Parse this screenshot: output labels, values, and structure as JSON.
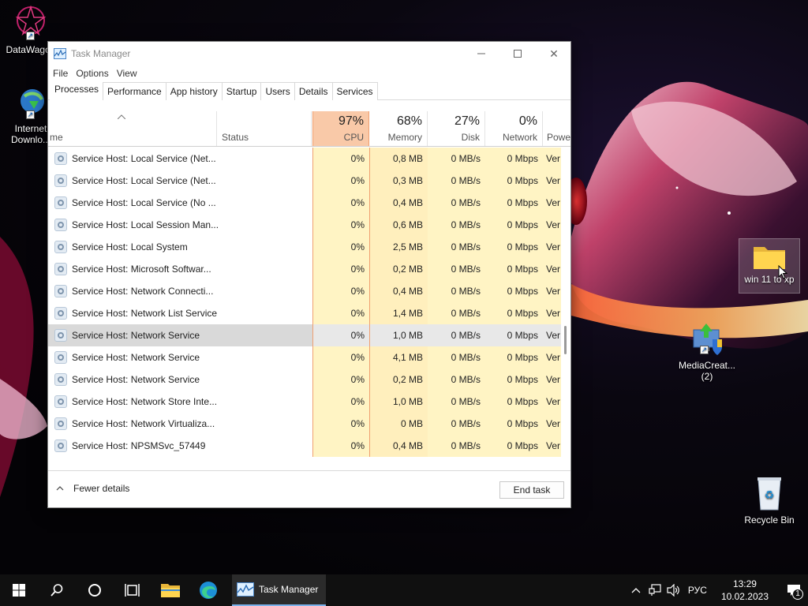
{
  "desktop": {
    "icons": [
      {
        "label": "DataWagon"
      },
      {
        "label": "Internet Downlo..."
      },
      {
        "label": "win 11 to xp"
      },
      {
        "label": "MediaCreat... (2)"
      },
      {
        "label": "Recycle Bin"
      }
    ]
  },
  "window": {
    "title": "Task Manager",
    "close_glyph": "✕",
    "menu": [
      "File",
      "Options",
      "View"
    ],
    "tabs": [
      "Processes",
      "Performance",
      "App history",
      "Startup",
      "Users",
      "Details",
      "Services"
    ],
    "active_tab": "Processes"
  },
  "table": {
    "columns": {
      "name": "me",
      "status": "Status",
      "cpu": {
        "pct": "97%",
        "label": "CPU"
      },
      "memory": {
        "pct": "68%",
        "label": "Memory"
      },
      "disk": {
        "pct": "27%",
        "label": "Disk"
      },
      "network": {
        "pct": "0%",
        "label": "Network"
      },
      "power": {
        "label": "Powe"
      }
    },
    "rows": [
      {
        "name": "Service Host: Local Service (Net...",
        "cpu": "0%",
        "mem": "0,8 MB",
        "disk": "0 MB/s",
        "net": "0 Mbps",
        "power": "Ver"
      },
      {
        "name": "Service Host: Local Service (Net...",
        "cpu": "0%",
        "mem": "0,3 MB",
        "disk": "0 MB/s",
        "net": "0 Mbps",
        "power": "Ver"
      },
      {
        "name": "Service Host: Local Service (No ...",
        "cpu": "0%",
        "mem": "0,4 MB",
        "disk": "0 MB/s",
        "net": "0 Mbps",
        "power": "Ver"
      },
      {
        "name": "Service Host: Local Session Man...",
        "cpu": "0%",
        "mem": "0,6 MB",
        "disk": "0 MB/s",
        "net": "0 Mbps",
        "power": "Ver"
      },
      {
        "name": "Service Host: Local System",
        "cpu": "0%",
        "mem": "2,5 MB",
        "disk": "0 MB/s",
        "net": "0 Mbps",
        "power": "Ver"
      },
      {
        "name": "Service Host: Microsoft Softwar...",
        "cpu": "0%",
        "mem": "0,2 MB",
        "disk": "0 MB/s",
        "net": "0 Mbps",
        "power": "Ver"
      },
      {
        "name": "Service Host: Network Connecti...",
        "cpu": "0%",
        "mem": "0,4 MB",
        "disk": "0 MB/s",
        "net": "0 Mbps",
        "power": "Ver"
      },
      {
        "name": "Service Host: Network List Service",
        "cpu": "0%",
        "mem": "1,4 MB",
        "disk": "0 MB/s",
        "net": "0 Mbps",
        "power": "Ver"
      },
      {
        "name": "Service Host: Network Service",
        "cpu": "0%",
        "mem": "1,0 MB",
        "disk": "0 MB/s",
        "net": "0 Mbps",
        "power": "Ver"
      },
      {
        "name": "Service Host: Network Service",
        "cpu": "0%",
        "mem": "4,1 MB",
        "disk": "0 MB/s",
        "net": "0 Mbps",
        "power": "Ver"
      },
      {
        "name": "Service Host: Network Service",
        "cpu": "0%",
        "mem": "0,2 MB",
        "disk": "0 MB/s",
        "net": "0 Mbps",
        "power": "Ver"
      },
      {
        "name": "Service Host: Network Store Inte...",
        "cpu": "0%",
        "mem": "1,0 MB",
        "disk": "0 MB/s",
        "net": "0 Mbps",
        "power": "Ver"
      },
      {
        "name": "Service Host: Network Virtualiza...",
        "cpu": "0%",
        "mem": "0 MB",
        "disk": "0 MB/s",
        "net": "0 Mbps",
        "power": "Ver"
      },
      {
        "name": "Service Host: NPSMSvc_57449",
        "cpu": "0%",
        "mem": "0,4 MB",
        "disk": "0 MB/s",
        "net": "0 Mbps",
        "power": "Ver"
      }
    ],
    "selected_row": 8
  },
  "footer": {
    "fewer_details": "Fewer details",
    "end_task": "End task"
  },
  "taskbar": {
    "task_label": "Task Manager",
    "language": "РУС",
    "time": "13:29",
    "date": "10.02.2023",
    "notification_count": "1"
  },
  "colors": {
    "cpu_header": "#f9c9a8",
    "cell_heat": "#fff4c4",
    "accent": "#7ab1ea"
  }
}
